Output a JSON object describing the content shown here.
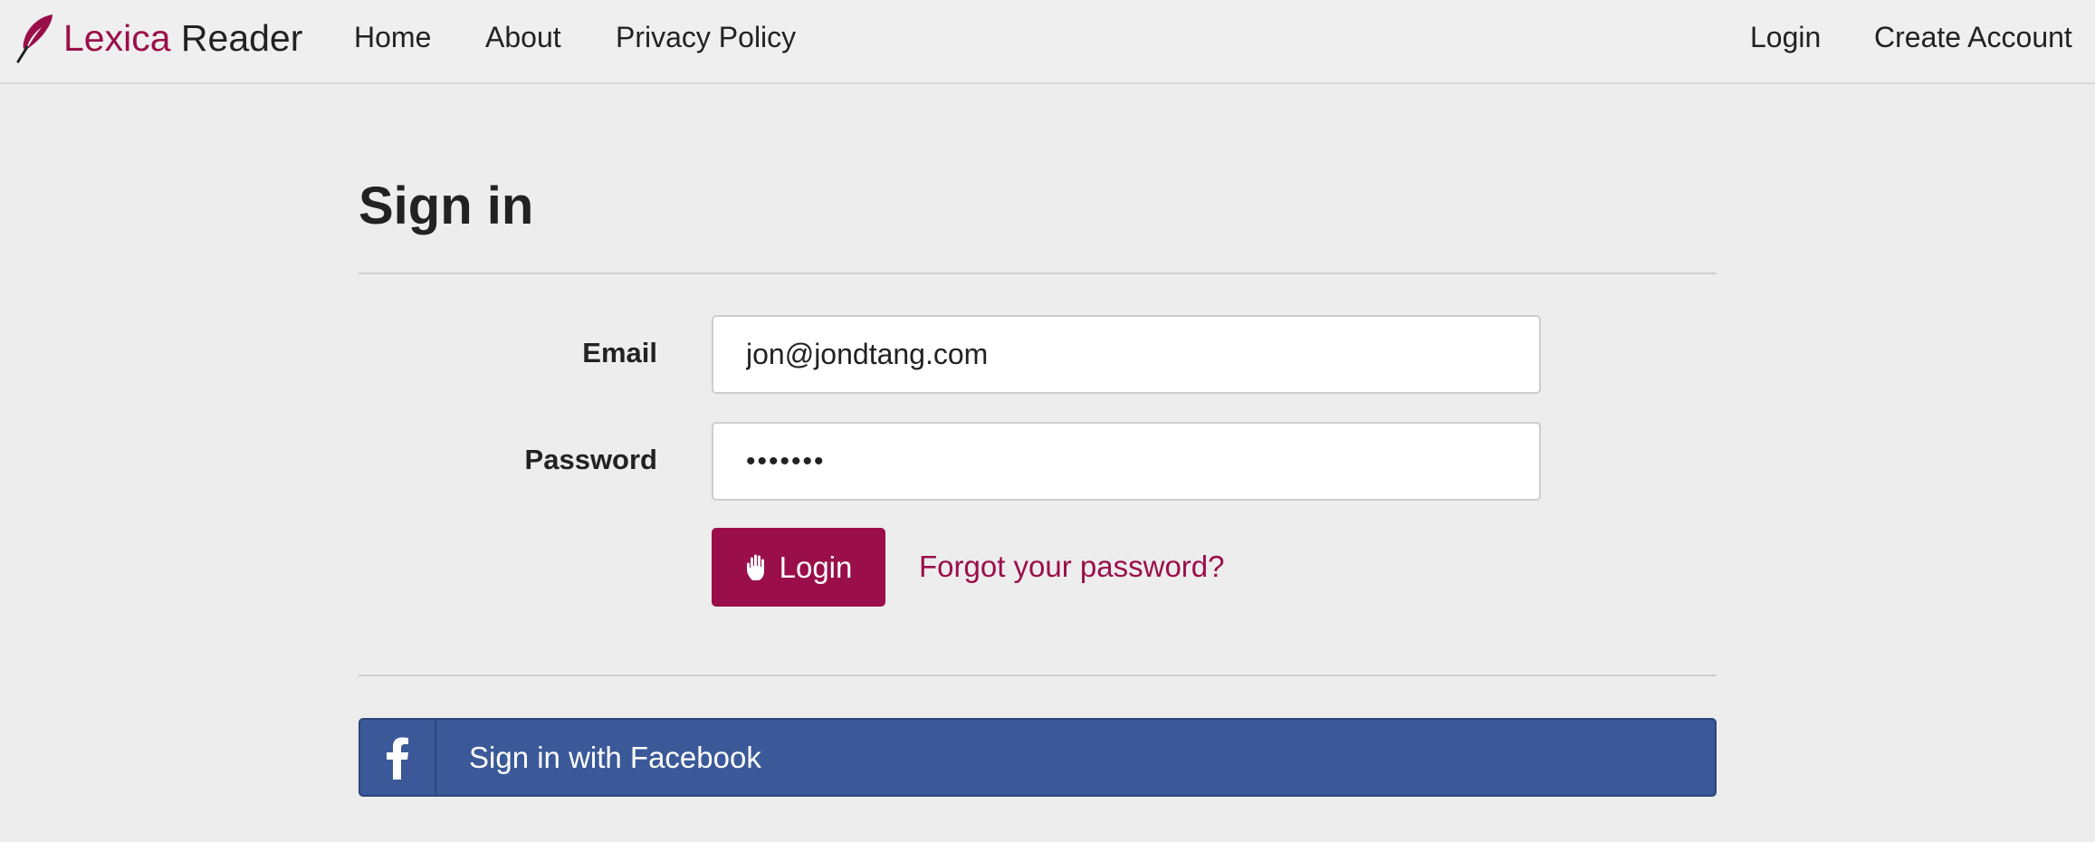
{
  "navbar": {
    "brand_accent": "Lexica",
    "brand_plain": " Reader",
    "brand_icon": "quill-icon",
    "links": [
      "Home",
      "About",
      "Privacy Policy"
    ],
    "right_links": [
      "Login",
      "Create Account"
    ]
  },
  "signin": {
    "title": "Sign in",
    "email_label": "Email",
    "email_value": "jon@jondtang.com",
    "password_label": "Password",
    "password_value": "•••••••",
    "login_button": "Login",
    "login_icon": "hand-icon",
    "forgot_link": "Forgot your password?",
    "facebook_button": "Sign in with Facebook",
    "facebook_icon": "facebook-icon"
  },
  "colors": {
    "accent": "#9a0f4a",
    "facebook": "#3b5998",
    "background": "#ededed"
  }
}
